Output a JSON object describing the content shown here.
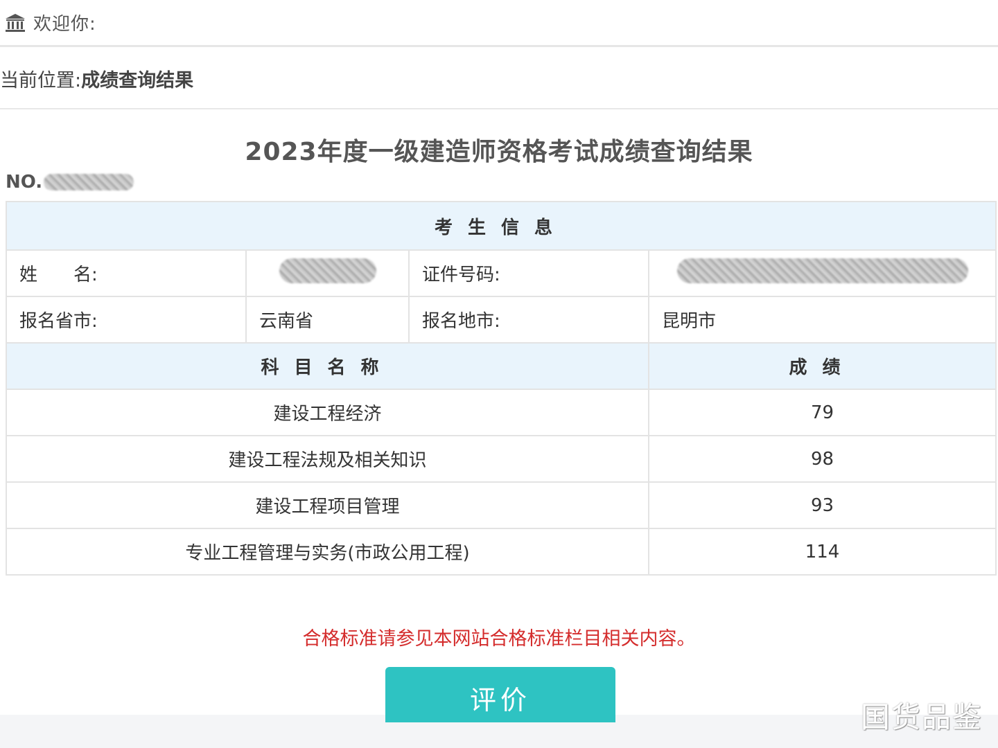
{
  "header": {
    "welcome_text": "欢迎你:"
  },
  "breadcrumb": {
    "prefix": "当前位置:",
    "current": "成绩查询结果"
  },
  "title": "2023年度一级建造师资格考试成绩查询结果",
  "serial": {
    "label": "NO."
  },
  "table": {
    "candidate_header": "考生信息",
    "name_label": "姓　　名:",
    "id_label": "证件号码:",
    "province_label": "报名省市:",
    "province_value": "云南省",
    "city_label": "报名地市:",
    "city_value": "昆明市",
    "subject_header": "科目名称",
    "score_header": "成绩",
    "subjects": [
      {
        "name": "建设工程经济",
        "score": "79"
      },
      {
        "name": "建设工程法规及相关知识",
        "score": "98"
      },
      {
        "name": "建设工程项目管理",
        "score": "93"
      },
      {
        "name": "专业工程管理与实务(市政公用工程)",
        "score": "114"
      }
    ]
  },
  "note": "合格标准请参见本网站合格标准栏目相关内容。",
  "evaluate_button": "评价",
  "watermark": "国货品鉴",
  "colors": {
    "header_bg": "#e9f4fc",
    "note_red": "#d42c2c",
    "button_teal": "#2ec3c2"
  },
  "icons": [
    "bank-icon"
  ]
}
